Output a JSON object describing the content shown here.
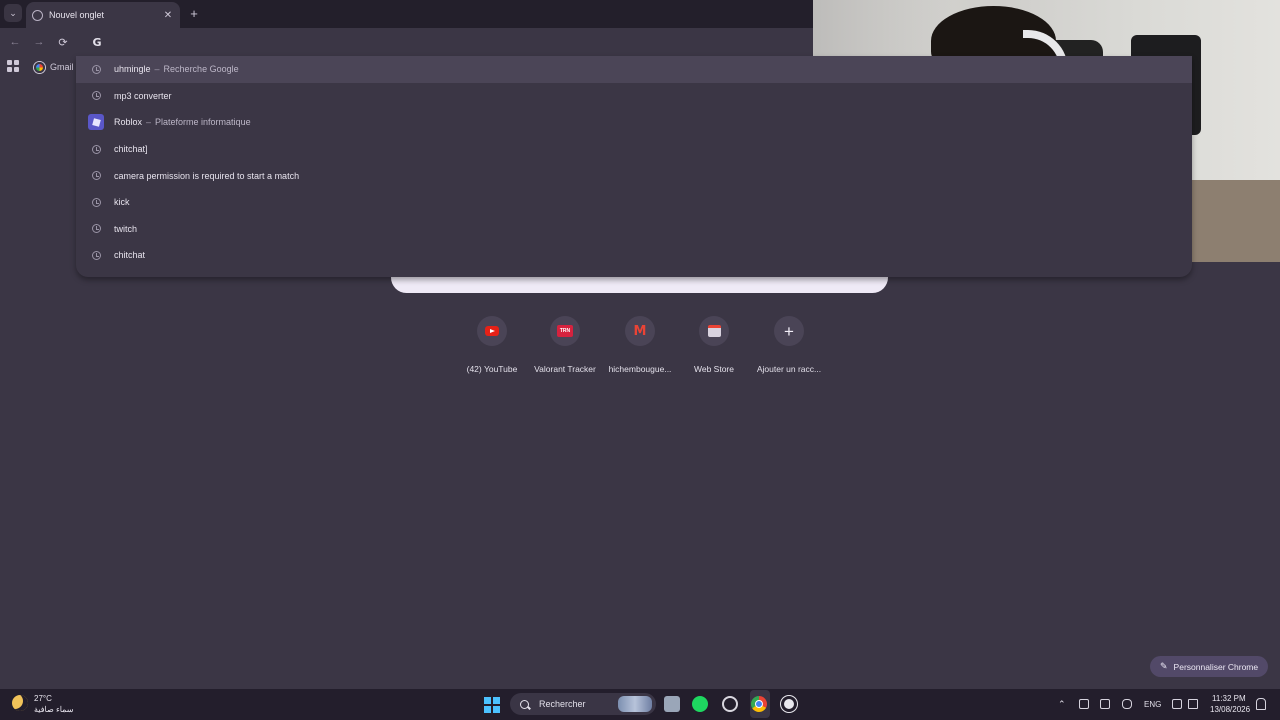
{
  "tab": {
    "title": "Nouvel onglet",
    "close": "✕",
    "new_tab": "+",
    "menu": "⌄"
  },
  "toolbar": {
    "back": "←",
    "forward": "→",
    "reload": "⟳",
    "omnibox_glyph": "G"
  },
  "bookmarks": {
    "gmail_label": "Gmail"
  },
  "suggestions": [
    {
      "icon": "history-icon",
      "text": "uhmingle",
      "desc": "Recherche Google",
      "active": true
    },
    {
      "icon": "history-icon",
      "text": "mp3 converter",
      "desc": ""
    },
    {
      "icon": "roblox-icon",
      "text": "Roblox",
      "desc": "Plateforme informatique"
    },
    {
      "icon": "history-icon",
      "text": "chitchat]",
      "desc": ""
    },
    {
      "icon": "history-icon",
      "text": "camera permission is required to start a match",
      "desc": ""
    },
    {
      "icon": "history-icon",
      "text": "kick",
      "desc": ""
    },
    {
      "icon": "history-icon",
      "text": "twitch",
      "desc": ""
    },
    {
      "icon": "history-icon",
      "text": "chitchat",
      "desc": ""
    }
  ],
  "suggestion_separator": "–",
  "shortcuts": [
    {
      "label": "(42) YouTube",
      "icon": "youtube-icon"
    },
    {
      "label": "Valorant Tracker",
      "icon": "trn-icon",
      "icon_text": "TRN"
    },
    {
      "label": "hichembougue...",
      "icon": "gmail-icon",
      "icon_text": "M"
    },
    {
      "label": "Web Store",
      "icon": "webstore-icon"
    },
    {
      "label": "Ajouter un racc...",
      "icon": "plus-icon",
      "icon_text": "+"
    }
  ],
  "customize": {
    "label": "Personnaliser Chrome",
    "icon": "✎"
  },
  "taskbar": {
    "weather_temp": "27°C",
    "weather_desc": "سماء صافية",
    "search_label": "Rechercher",
    "tray_chevron": "⌃",
    "language": "ENG",
    "time": "11:32 PM",
    "date": "13/08/2026"
  },
  "colors": {
    "accent": "#524968",
    "background": "#3b3645",
    "tabstrip": "#231f2b",
    "taskbar": "#231e2c"
  }
}
